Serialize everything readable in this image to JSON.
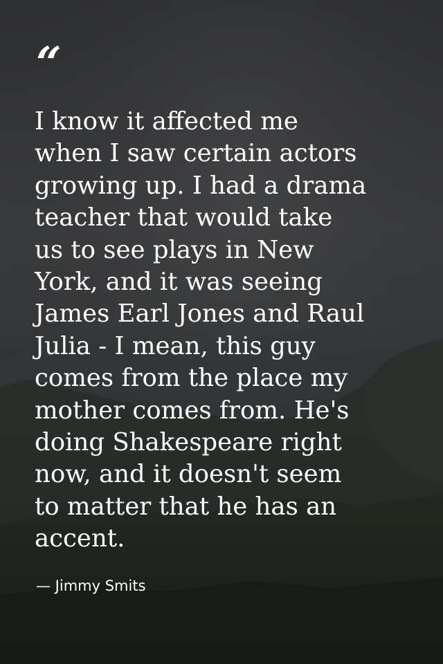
{
  "quote": {
    "mark": "“",
    "text": "I know it affected me\nwhen I saw certain actors\ngrowing up. I had a drama\nteacher that would take\nus to see plays in New\nYork, and it was seeing\nJames Earl Jones and Raul\nJulia - I mean, this guy\ncomes from the place my\nmother comes from. He's\ndoing Shakespeare right\nnow, and it doesn't seem\nto matter that he has an\naccent.",
    "attribution": "— Jimmy Smits"
  },
  "colors": {
    "text": "#ffffff",
    "sky": "#3a3b3d",
    "hills": "#1f231f"
  }
}
